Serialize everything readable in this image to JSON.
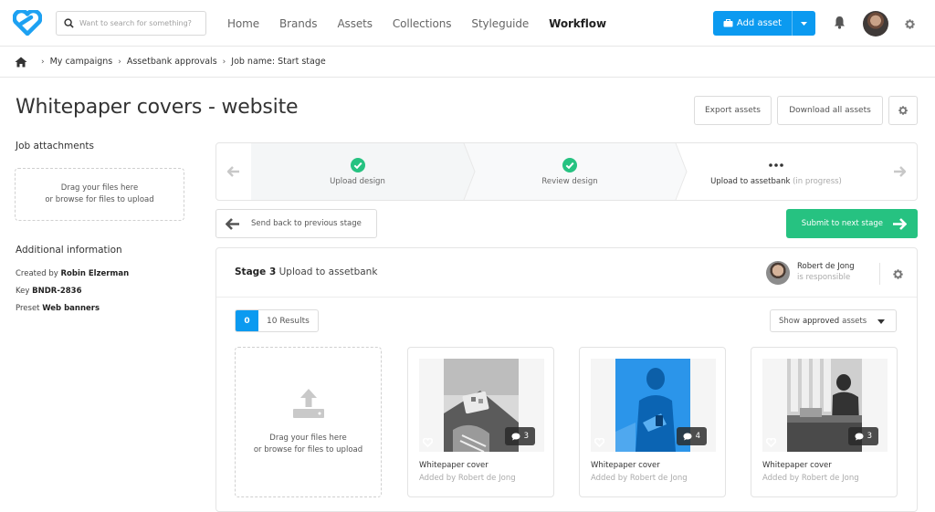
{
  "nav": {
    "search_placeholder": "Want to search for something?",
    "links": [
      "Home",
      "Brands",
      "Assets",
      "Collections",
      "Styleguide",
      "Workflow"
    ],
    "active": "Workflow",
    "add_asset_label": "Add asset"
  },
  "breadcrumb": [
    "My campaigns",
    "Assetbank approvals",
    "Job name: Start stage"
  ],
  "page": {
    "title": "Whitepaper covers - website",
    "export_label": "Export assets",
    "download_label": "Download all assets"
  },
  "sidebar": {
    "attachments_title": "Job attachments",
    "drop_line1": "Drag your files here",
    "drop_line2": "or browse for files to upload",
    "info_title": "Additional information",
    "created_by_label": "Created by",
    "created_by_value": "Robin Elzerman",
    "key_label": "Key",
    "key_value": "BNDR-2836",
    "preset_label": "Preset",
    "preset_value": "Web banners"
  },
  "stages": [
    {
      "label": "Upload design",
      "status": "done"
    },
    {
      "label": "Review design",
      "status": "done"
    },
    {
      "label": "Upload to assetbank",
      "status": "in-progress",
      "status_text": "(in progress)"
    }
  ],
  "actions": {
    "back_label": "Send back to previous stage",
    "next_label": "Submit to next stage"
  },
  "stage_panel": {
    "stage_prefix": "Stage 3",
    "stage_name": "Upload to assetbank",
    "responsible_name": "Robert de Jong",
    "responsible_sub": "is responsible",
    "selected_count": "0",
    "results_label": "10 Results",
    "filter_prefix": "Show",
    "filter_value": "approved",
    "filter_suffix": "assets",
    "drop_line1": "Drag your files here",
    "drop_line2": "or browse for files to upload"
  },
  "assets": [
    {
      "title": "Whitepaper cover",
      "added_by": "Added by Robert de Jong",
      "comments": "3",
      "tone": "gray"
    },
    {
      "title": "Whitepaper cover",
      "added_by": "Added by Robert de Jong",
      "comments": "4",
      "tone": "blue"
    },
    {
      "title": "Whitepaper cover",
      "added_by": "Added by Robert de Jong",
      "comments": "3",
      "tone": "gray"
    }
  ],
  "colors": {
    "primary": "#0b9af0",
    "success": "#26c281"
  }
}
